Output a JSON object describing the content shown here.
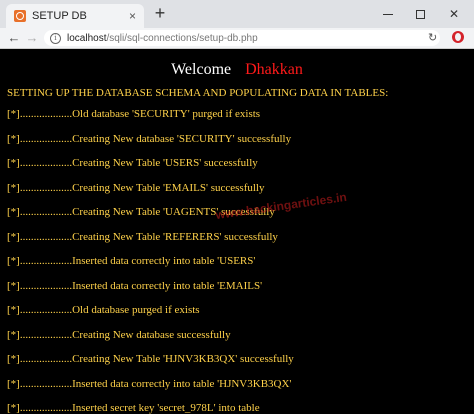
{
  "browser": {
    "tab_title": "SETUP DB",
    "tab_close": "×",
    "new_tab": "+",
    "url_host": "localhost",
    "url_path": "/sqli/sql-connections/setup-db.php",
    "back": "←",
    "forward": "→",
    "reload": "↻",
    "info": "i",
    "win_close": "✕"
  },
  "page": {
    "welcome": "Welcome",
    "user_name": "Dhakkan",
    "heading": "SETTING UP THE DATABASE SCHEMA AND POPULATING DATA IN TABLES:",
    "watermark": "www.hackingarticles.in",
    "log_lines": [
      "[*]...................Old database 'SECURITY' purged if exists",
      "[*]...................Creating New database 'SECURITY' successfully",
      "[*]...................Creating New Table 'USERS' successfully",
      "[*]...................Creating New Table 'EMAILS' successfully",
      "[*]...................Creating New Table 'UAGENTS' successfully",
      "[*]...................Creating New Table 'REFERERS' successfully",
      "[*]...................Inserted data correctly into table 'USERS'",
      "[*]...................Inserted data correctly into table 'EMAILS'",
      "[*]...................Old database purged if exists",
      "[*]...................Creating New database successfully",
      "[*]...................Creating New Table 'HJNV3KB3QX' successfully",
      "[*]...................Inserted data correctly into table 'HJNV3KB3QX'",
      "[*]...................Inserted secret key 'secret_978L' into table"
    ]
  }
}
